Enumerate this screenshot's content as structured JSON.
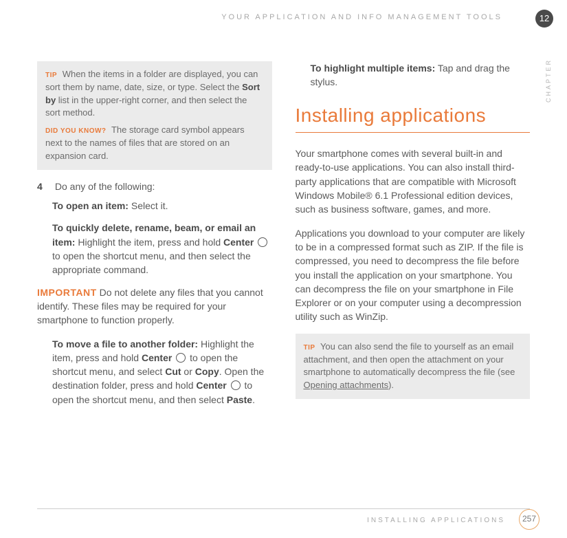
{
  "header": {
    "running_head": "YOUR APPLICATION AND INFO MANAGEMENT TOOLS",
    "chapter_number": "12",
    "chapter_side_label": "CHAPTER"
  },
  "left_col": {
    "tip1": {
      "label": "TIP",
      "text_parts": {
        "t1": "When the items in a folder are displayed, you can sort them by name, date, size, or type. Select the ",
        "sort_by": "Sort by",
        "t2": " list in the upper-right corner, and then select the sort method."
      }
    },
    "tip2": {
      "label": "DID YOU KNOW?",
      "text": "The storage card symbol appears next to the names of files that are stored on an expansion card."
    },
    "step4": {
      "num": "4",
      "lead": "Do any of the following:"
    },
    "open_item": {
      "label": "To open an item:",
      "rest": " Select it."
    },
    "quick_delete": {
      "label": "To quickly delete, rename, beam, or email an item:",
      "t1": " Highlight the item, press and hold ",
      "center": "Center",
      "t2": " to open the shortcut menu, and then select the appropriate command."
    },
    "important": {
      "label": "IMPORTANT",
      "text": " Do not delete any files that you cannot identify. These files may be required for your smartphone to function properly."
    },
    "move_file": {
      "label": "To move a file to another folder:",
      "t1": " Highlight the item, press and hold ",
      "center1": "Center",
      "t2": " to open the shortcut menu, and select ",
      "cut": "Cut",
      "or": " or ",
      "copy": "Copy",
      "t3": ". Open the destination folder, press and hold ",
      "center2": "Center",
      "t4": " to open the shortcut menu, and then select ",
      "paste": "Paste",
      "t5": "."
    }
  },
  "right_col": {
    "highlight_multi": {
      "label": "To highlight multiple items:",
      "rest": " Tap and drag the stylus."
    },
    "section_title": "Installing applications",
    "para1": "Your smartphone comes with several built-in and ready-to-use applications. You can also install third-party applications that are compatible with Microsoft Windows Mobile® 6.1 Professional edition devices, such as business software, games, and more.",
    "para2": "Applications you download to your computer are likely to be in a compressed format such as ZIP. If the file is compressed, you need to decompress the file before you install the application on your smartphone. You can decompress the file on your smartphone in File Explorer or on your computer using a decompression utility such as WinZip.",
    "tip": {
      "label": "TIP",
      "t1": "You can also send the file to yourself as an email attachment, and then open the attachment on your smartphone to automatically decompress the file (see ",
      "link": "Opening attachments",
      "t2": ")."
    }
  },
  "footer": {
    "section_label": "INSTALLING APPLICATIONS",
    "page_number": "257"
  }
}
